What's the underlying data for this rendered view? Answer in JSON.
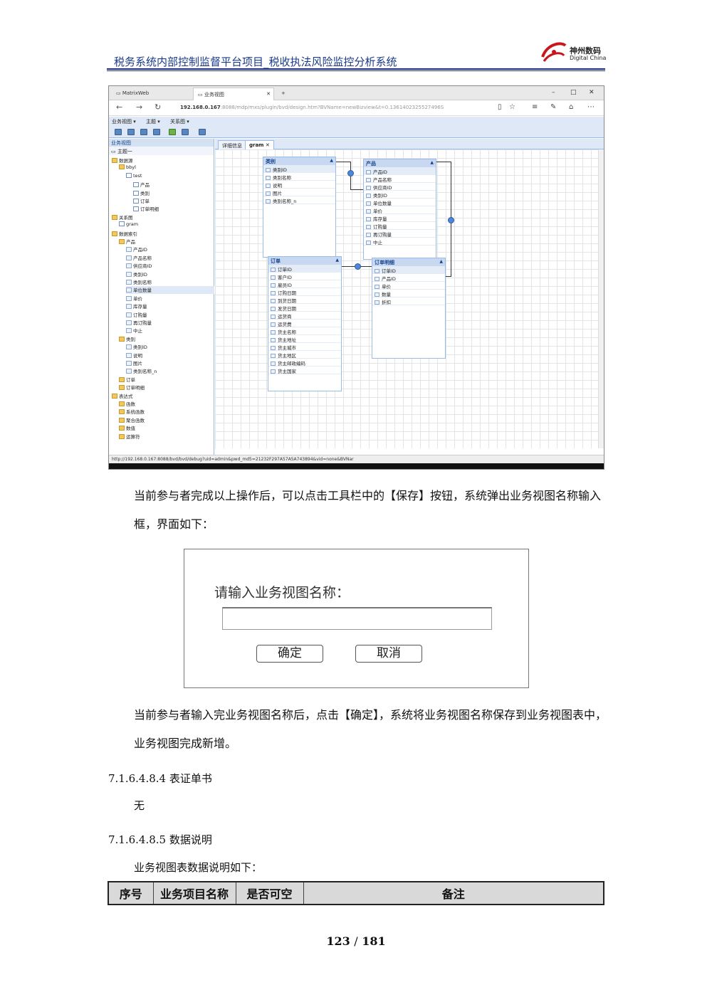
{
  "header": {
    "title": "税务系统内部控制监督平台项目_税收执法风险监控分析系统",
    "logo_cn": "神州数码",
    "logo_en": "Digital China"
  },
  "browser": {
    "tab1": "MatrixWeb",
    "tab2": "业务视图",
    "url_host": "192.168.0.167",
    "url_rest": ":8088/mdp/mxs/plugin/bvd/design.htm?BVName=newBizview&t=0.1361402325527496S",
    "menu": [
      "业务视图 ▾",
      "主题 ▾",
      "关系图 ▾"
    ],
    "left_panel_title": "业务视图",
    "left_subtitle": "主题一",
    "tree": [
      {
        "label": "数据源",
        "indent": 0,
        "icon": "folder"
      },
      {
        "label": "bbyl",
        "indent": 1,
        "icon": "folder"
      },
      {
        "label": "test",
        "indent": 2,
        "icon": "tbl"
      },
      {
        "label": "产品",
        "indent": 3,
        "icon": "tbl"
      },
      {
        "label": "类别",
        "indent": 3,
        "icon": "tbl"
      },
      {
        "label": "订单",
        "indent": 3,
        "icon": "tbl"
      },
      {
        "label": "订单明细",
        "indent": 3,
        "icon": "tbl"
      },
      {
        "label": "关系图",
        "indent": 0,
        "icon": "folder"
      },
      {
        "label": "gram",
        "indent": 1,
        "icon": "tbl"
      },
      {
        "label": "数据索引",
        "indent": 0,
        "icon": "folder"
      },
      {
        "label": "产品",
        "indent": 1,
        "icon": "folder"
      },
      {
        "label": "产品ID",
        "indent": 2,
        "icon": "field"
      },
      {
        "label": "产品名称",
        "indent": 2,
        "icon": "field"
      },
      {
        "label": "供应商ID",
        "indent": 2,
        "icon": "field"
      },
      {
        "label": "类别ID",
        "indent": 2,
        "icon": "field"
      },
      {
        "label": "类别名称",
        "indent": 2,
        "icon": "field"
      },
      {
        "label": "单位数量",
        "indent": 2,
        "icon": "field"
      },
      {
        "label": "单价",
        "indent": 2,
        "icon": "field"
      },
      {
        "label": "库存量",
        "indent": 2,
        "icon": "field"
      },
      {
        "label": "订购量",
        "indent": 2,
        "icon": "field"
      },
      {
        "label": "再订购量",
        "indent": 2,
        "icon": "field"
      },
      {
        "label": "中止",
        "indent": 2,
        "icon": "field"
      },
      {
        "label": "类别",
        "indent": 1,
        "icon": "folder"
      },
      {
        "label": "类别ID",
        "indent": 2,
        "icon": "field"
      },
      {
        "label": "说明",
        "indent": 2,
        "icon": "field"
      },
      {
        "label": "图片",
        "indent": 2,
        "icon": "field"
      },
      {
        "label": "类别名称_n",
        "indent": 2,
        "icon": "field"
      },
      {
        "label": "订单",
        "indent": 1,
        "icon": "folder"
      },
      {
        "label": "订单明细",
        "indent": 1,
        "icon": "folder"
      },
      {
        "label": "表达式",
        "indent": 0,
        "icon": "folder"
      },
      {
        "label": "函数",
        "indent": 1,
        "icon": "folder"
      },
      {
        "label": "系统函数",
        "indent": 1,
        "icon": "folder"
      },
      {
        "label": "聚合函数",
        "indent": 1,
        "icon": "folder"
      },
      {
        "label": "数值",
        "indent": 1,
        "icon": "folder"
      },
      {
        "label": "运算符",
        "indent": 1,
        "icon": "folder"
      }
    ],
    "right_tabs": [
      "详细信息",
      "gram"
    ],
    "entities": {
      "category": {
        "name": "类别",
        "fields": [
          "类别ID",
          "类别名称",
          "说明",
          "图片",
          "类别名称_n"
        ]
      },
      "product": {
        "name": "产品",
        "fields": [
          "产品ID",
          "产品名称",
          "供应商ID",
          "类别ID",
          "单位数量",
          "单价",
          "库存量",
          "订购量",
          "再订购量",
          "中止"
        ]
      },
      "order": {
        "name": "订单",
        "fields": [
          "订单ID",
          "客户ID",
          "雇员ID",
          "订购日期",
          "到货日期",
          "发货日期",
          "运货商",
          "运货费",
          "货主名称",
          "货主地址",
          "货主城市",
          "货主地区",
          "货主邮政编码",
          "货主国家"
        ]
      },
      "order_detail": {
        "name": "订单明细",
        "fields": [
          "订单ID",
          "产品ID",
          "单价",
          "数量",
          "折扣"
        ]
      }
    },
    "status_url": "http://192.168.0.167:8088/bvd/bvd/debug?uid=admin&pwd_md5=21232F297A57A5A743894&vid=none&BVNar"
  },
  "paragraph1": "当前参与者完成以上操作后，可以点击工具栏中的【保存】按钮，系统弹出业务视图名称输入框，界面如下：",
  "dialog": {
    "prompt": "请输入业务视图名称：",
    "input_value": "",
    "confirm": "确定",
    "cancel": "取消"
  },
  "paragraph2": "当前参与者输入完业务视图名称后，点击【确定】，系统将业务视图名称保存到业务视图表中，业务视图完成新增。",
  "section1": "7.1.6.4.8.4 表证单书",
  "section1_body": "无",
  "section2": "7.1.6.4.8.5 数据说明",
  "section2_body": "业务视图表数据说明如下：",
  "table": {
    "headers": [
      "序号",
      "业务项目名称",
      "是否可空",
      "备注"
    ]
  },
  "page": {
    "current": "123",
    "separator": "/",
    "total": "181"
  }
}
